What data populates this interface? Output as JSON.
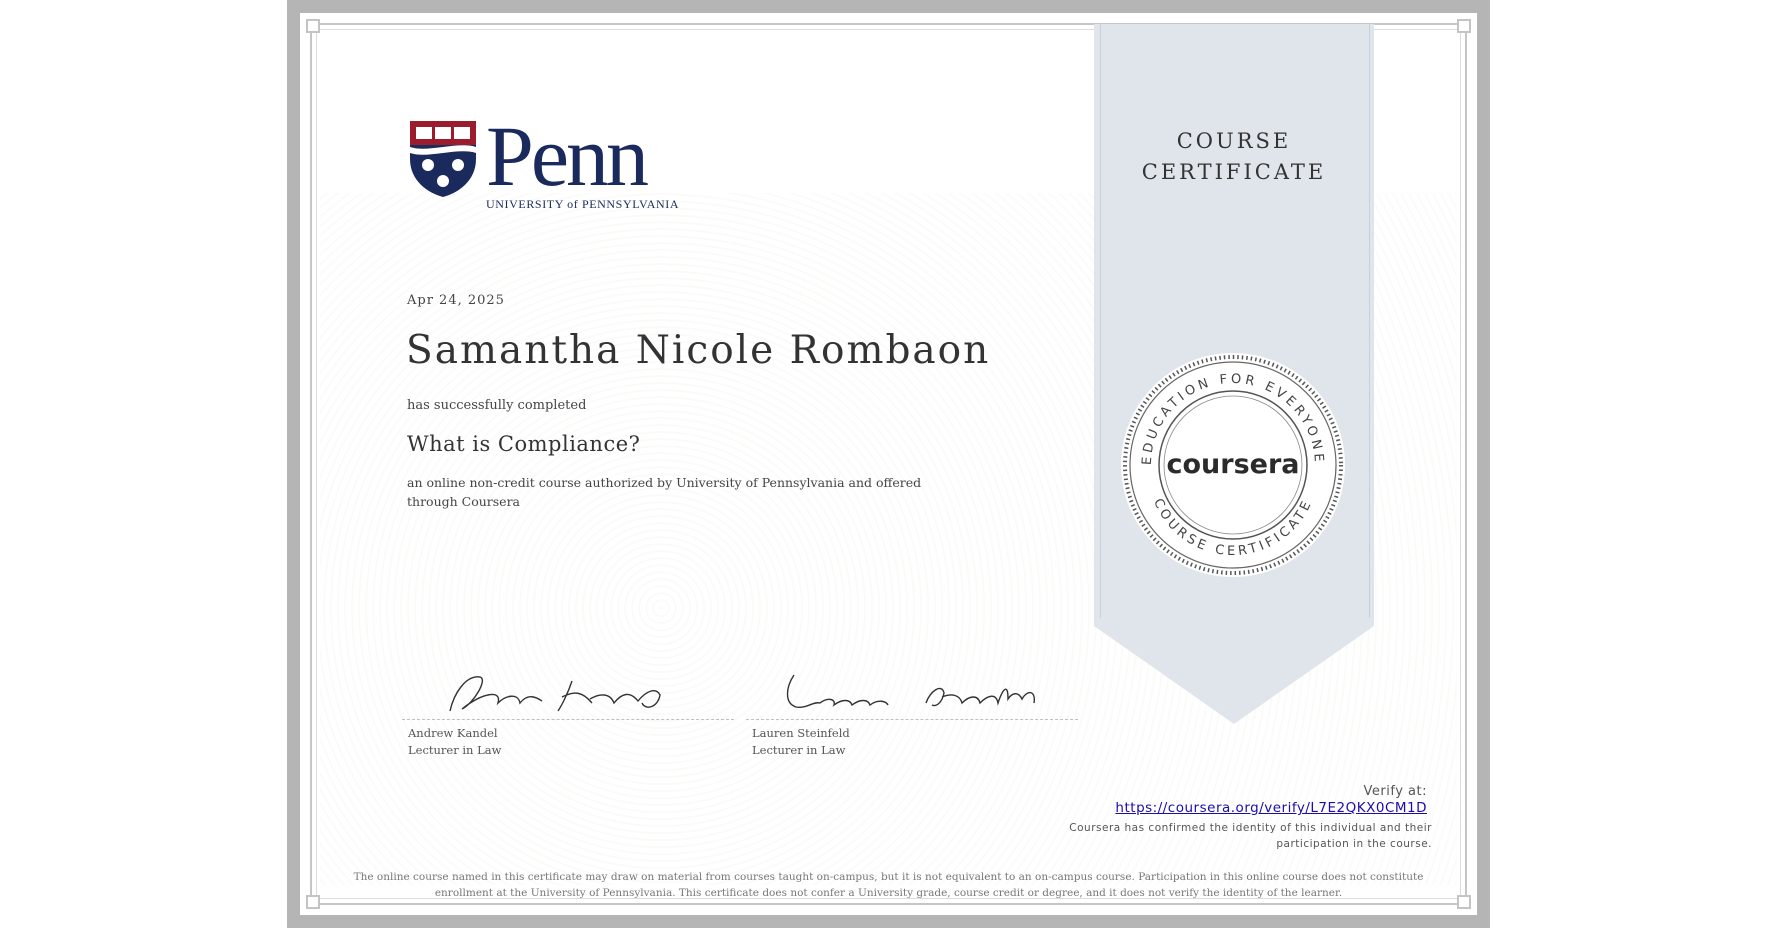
{
  "institution": {
    "logo_word": "Penn",
    "logo_subtitle": "UNIVERSITY of PENNSYLVANIA",
    "shield_color": "#9b1c2c",
    "navy_color": "#1b2a5c"
  },
  "certificate": {
    "date": "Apr 24, 2025",
    "recipient_name": "Samantha Nicole Rombaon",
    "completed_text": "has successfully completed",
    "course_title": "What is Compliance?",
    "description": "an online non-credit course authorized by University of Pennsylvania and offered through Coursera",
    "ribbon_title_line1": "COURSE",
    "ribbon_title_line2": "CERTIFICATE"
  },
  "seal": {
    "brand": "coursera",
    "top_arc": "EDUCATION FOR EVERYONE",
    "bottom_arc": "COURSE CERTIFICATE"
  },
  "signatures": [
    {
      "name": "Andrew Kandel",
      "title": "Lecturer in Law"
    },
    {
      "name": "Lauren Steinfeld",
      "title": "Lecturer in Law"
    }
  ],
  "verify": {
    "label": "Verify at:",
    "url": "https://coursera.org/verify/L7E2QKX0CM1D",
    "note": "Coursera has confirmed the identity of this individual and their participation in the course."
  },
  "disclaimer": "The online course named in this certificate may draw on material from courses taught on-campus, but it is not equivalent to an on-campus course. Participation in this online course does not constitute enrollment at the University of Pennsylvania. This certificate does not confer a University grade, course credit or degree, and it does not verify the identity of the learner."
}
